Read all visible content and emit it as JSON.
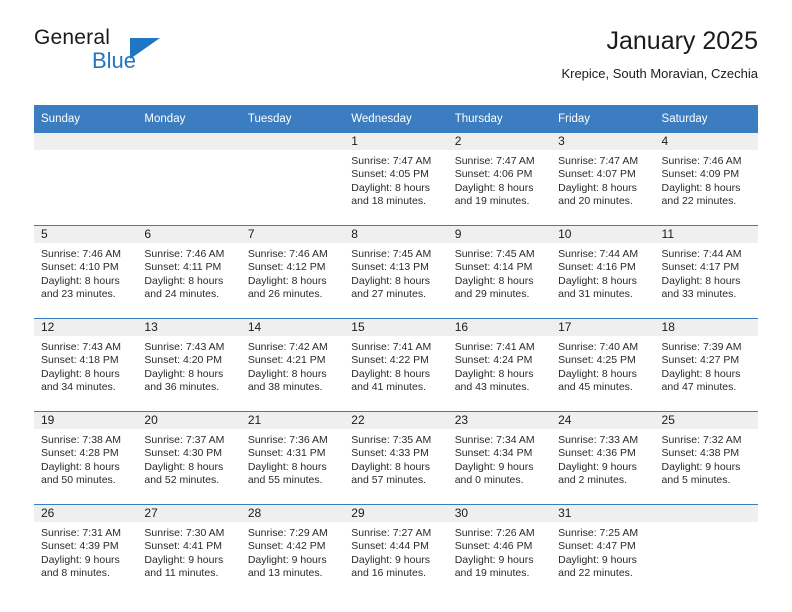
{
  "brand": {
    "name_top": "General",
    "name_bottom": "Blue",
    "triangle_color": "#1f77c4"
  },
  "header": {
    "title": "January 2025",
    "subtitle": "Krepice, South Moravian, Czechia"
  },
  "theme": {
    "header_bg": "#3b7dc0",
    "header_text": "#ffffff",
    "daynum_band_bg": "#efefef",
    "divider": "#3b7dc0"
  },
  "labels": {
    "sunrise_prefix": "Sunrise:",
    "sunset_prefix": "Sunset:",
    "daylight_prefix": "Daylight:"
  },
  "weekday_headers": [
    "Sunday",
    "Monday",
    "Tuesday",
    "Wednesday",
    "Thursday",
    "Friday",
    "Saturday"
  ],
  "weeks": [
    [
      {
        "day": "",
        "empty": true
      },
      {
        "day": "",
        "empty": true
      },
      {
        "day": "",
        "empty": true
      },
      {
        "day": "1",
        "sunrise": "Sunrise: 7:47 AM",
        "sunset": "Sunset: 4:05 PM",
        "daylight_line1": "Daylight: 8 hours",
        "daylight_line2": "and 18 minutes."
      },
      {
        "day": "2",
        "sunrise": "Sunrise: 7:47 AM",
        "sunset": "Sunset: 4:06 PM",
        "daylight_line1": "Daylight: 8 hours",
        "daylight_line2": "and 19 minutes."
      },
      {
        "day": "3",
        "sunrise": "Sunrise: 7:47 AM",
        "sunset": "Sunset: 4:07 PM",
        "daylight_line1": "Daylight: 8 hours",
        "daylight_line2": "and 20 minutes."
      },
      {
        "day": "4",
        "sunrise": "Sunrise: 7:46 AM",
        "sunset": "Sunset: 4:09 PM",
        "daylight_line1": "Daylight: 8 hours",
        "daylight_line2": "and 22 minutes."
      }
    ],
    [
      {
        "day": "5",
        "sunrise": "Sunrise: 7:46 AM",
        "sunset": "Sunset: 4:10 PM",
        "daylight_line1": "Daylight: 8 hours",
        "daylight_line2": "and 23 minutes."
      },
      {
        "day": "6",
        "sunrise": "Sunrise: 7:46 AM",
        "sunset": "Sunset: 4:11 PM",
        "daylight_line1": "Daylight: 8 hours",
        "daylight_line2": "and 24 minutes."
      },
      {
        "day": "7",
        "sunrise": "Sunrise: 7:46 AM",
        "sunset": "Sunset: 4:12 PM",
        "daylight_line1": "Daylight: 8 hours",
        "daylight_line2": "and 26 minutes."
      },
      {
        "day": "8",
        "sunrise": "Sunrise: 7:45 AM",
        "sunset": "Sunset: 4:13 PM",
        "daylight_line1": "Daylight: 8 hours",
        "daylight_line2": "and 27 minutes."
      },
      {
        "day": "9",
        "sunrise": "Sunrise: 7:45 AM",
        "sunset": "Sunset: 4:14 PM",
        "daylight_line1": "Daylight: 8 hours",
        "daylight_line2": "and 29 minutes."
      },
      {
        "day": "10",
        "sunrise": "Sunrise: 7:44 AM",
        "sunset": "Sunset: 4:16 PM",
        "daylight_line1": "Daylight: 8 hours",
        "daylight_line2": "and 31 minutes."
      },
      {
        "day": "11",
        "sunrise": "Sunrise: 7:44 AM",
        "sunset": "Sunset: 4:17 PM",
        "daylight_line1": "Daylight: 8 hours",
        "daylight_line2": "and 33 minutes."
      }
    ],
    [
      {
        "day": "12",
        "sunrise": "Sunrise: 7:43 AM",
        "sunset": "Sunset: 4:18 PM",
        "daylight_line1": "Daylight: 8 hours",
        "daylight_line2": "and 34 minutes."
      },
      {
        "day": "13",
        "sunrise": "Sunrise: 7:43 AM",
        "sunset": "Sunset: 4:20 PM",
        "daylight_line1": "Daylight: 8 hours",
        "daylight_line2": "and 36 minutes."
      },
      {
        "day": "14",
        "sunrise": "Sunrise: 7:42 AM",
        "sunset": "Sunset: 4:21 PM",
        "daylight_line1": "Daylight: 8 hours",
        "daylight_line2": "and 38 minutes."
      },
      {
        "day": "15",
        "sunrise": "Sunrise: 7:41 AM",
        "sunset": "Sunset: 4:22 PM",
        "daylight_line1": "Daylight: 8 hours",
        "daylight_line2": "and 41 minutes."
      },
      {
        "day": "16",
        "sunrise": "Sunrise: 7:41 AM",
        "sunset": "Sunset: 4:24 PM",
        "daylight_line1": "Daylight: 8 hours",
        "daylight_line2": "and 43 minutes."
      },
      {
        "day": "17",
        "sunrise": "Sunrise: 7:40 AM",
        "sunset": "Sunset: 4:25 PM",
        "daylight_line1": "Daylight: 8 hours",
        "daylight_line2": "and 45 minutes."
      },
      {
        "day": "18",
        "sunrise": "Sunrise: 7:39 AM",
        "sunset": "Sunset: 4:27 PM",
        "daylight_line1": "Daylight: 8 hours",
        "daylight_line2": "and 47 minutes."
      }
    ],
    [
      {
        "day": "19",
        "sunrise": "Sunrise: 7:38 AM",
        "sunset": "Sunset: 4:28 PM",
        "daylight_line1": "Daylight: 8 hours",
        "daylight_line2": "and 50 minutes."
      },
      {
        "day": "20",
        "sunrise": "Sunrise: 7:37 AM",
        "sunset": "Sunset: 4:30 PM",
        "daylight_line1": "Daylight: 8 hours",
        "daylight_line2": "and 52 minutes."
      },
      {
        "day": "21",
        "sunrise": "Sunrise: 7:36 AM",
        "sunset": "Sunset: 4:31 PM",
        "daylight_line1": "Daylight: 8 hours",
        "daylight_line2": "and 55 minutes."
      },
      {
        "day": "22",
        "sunrise": "Sunrise: 7:35 AM",
        "sunset": "Sunset: 4:33 PM",
        "daylight_line1": "Daylight: 8 hours",
        "daylight_line2": "and 57 minutes."
      },
      {
        "day": "23",
        "sunrise": "Sunrise: 7:34 AM",
        "sunset": "Sunset: 4:34 PM",
        "daylight_line1": "Daylight: 9 hours",
        "daylight_line2": "and 0 minutes."
      },
      {
        "day": "24",
        "sunrise": "Sunrise: 7:33 AM",
        "sunset": "Sunset: 4:36 PM",
        "daylight_line1": "Daylight: 9 hours",
        "daylight_line2": "and 2 minutes."
      },
      {
        "day": "25",
        "sunrise": "Sunrise: 7:32 AM",
        "sunset": "Sunset: 4:38 PM",
        "daylight_line1": "Daylight: 9 hours",
        "daylight_line2": "and 5 minutes."
      }
    ],
    [
      {
        "day": "26",
        "sunrise": "Sunrise: 7:31 AM",
        "sunset": "Sunset: 4:39 PM",
        "daylight_line1": "Daylight: 9 hours",
        "daylight_line2": "and 8 minutes."
      },
      {
        "day": "27",
        "sunrise": "Sunrise: 7:30 AM",
        "sunset": "Sunset: 4:41 PM",
        "daylight_line1": "Daylight: 9 hours",
        "daylight_line2": "and 11 minutes."
      },
      {
        "day": "28",
        "sunrise": "Sunrise: 7:29 AM",
        "sunset": "Sunset: 4:42 PM",
        "daylight_line1": "Daylight: 9 hours",
        "daylight_line2": "and 13 minutes."
      },
      {
        "day": "29",
        "sunrise": "Sunrise: 7:27 AM",
        "sunset": "Sunset: 4:44 PM",
        "daylight_line1": "Daylight: 9 hours",
        "daylight_line2": "and 16 minutes."
      },
      {
        "day": "30",
        "sunrise": "Sunrise: 7:26 AM",
        "sunset": "Sunset: 4:46 PM",
        "daylight_line1": "Daylight: 9 hours",
        "daylight_line2": "and 19 minutes."
      },
      {
        "day": "31",
        "sunrise": "Sunrise: 7:25 AM",
        "sunset": "Sunset: 4:47 PM",
        "daylight_line1": "Daylight: 9 hours",
        "daylight_line2": "and 22 minutes."
      },
      {
        "day": "",
        "empty": true
      }
    ]
  ]
}
